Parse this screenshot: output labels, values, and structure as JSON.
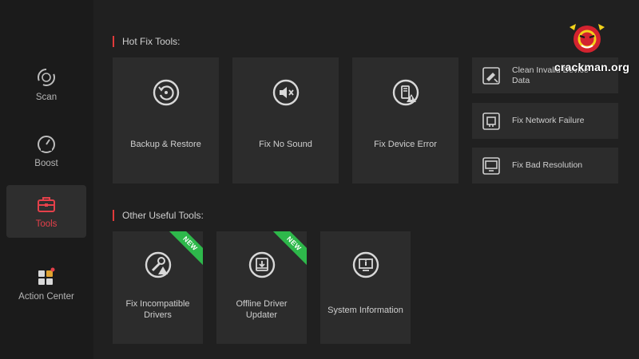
{
  "sidebar": {
    "items": [
      {
        "label": "Scan",
        "icon": "scan-icon"
      },
      {
        "label": "Boost",
        "icon": "speedometer-icon"
      },
      {
        "label": "Tools",
        "icon": "toolbox-icon",
        "active": true
      },
      {
        "label": "Action Center",
        "icon": "apps-grid-icon"
      }
    ]
  },
  "sections": {
    "hot_fix_title": "Hot Fix Tools:",
    "other_title": "Other Useful Tools:"
  },
  "hot_fix": {
    "big": [
      {
        "label": "Backup & Restore",
        "icon": "backup-restore-icon"
      },
      {
        "label": "Fix No Sound",
        "icon": "mute-speaker-icon"
      },
      {
        "label": "Fix Device Error",
        "icon": "device-warning-icon"
      }
    ],
    "small": [
      {
        "label_line1": "Clean Invalid Device",
        "label_line2": "Data",
        "icon": "clean-device-icon"
      },
      {
        "label_line1": "Fix Network Failure",
        "icon": "network-icon"
      },
      {
        "label_line1": "Fix Bad Resolution",
        "icon": "monitor-resolution-icon"
      }
    ]
  },
  "other": {
    "items": [
      {
        "label_line1": "Fix Incompatible",
        "label_line2": "Drivers",
        "badge": "NEW",
        "icon": "wrench-warning-icon"
      },
      {
        "label_line1": "Offline Driver",
        "label_line2": "Updater",
        "badge": "NEW",
        "icon": "offline-download-icon"
      },
      {
        "label_line1": "System Information",
        "icon": "system-info-icon"
      }
    ]
  },
  "watermark": {
    "text": "crackman.org"
  },
  "colors": {
    "accent": "#e5404a",
    "badge": "#2eb84b",
    "background": "#202020",
    "card": "#2c2c2c"
  }
}
